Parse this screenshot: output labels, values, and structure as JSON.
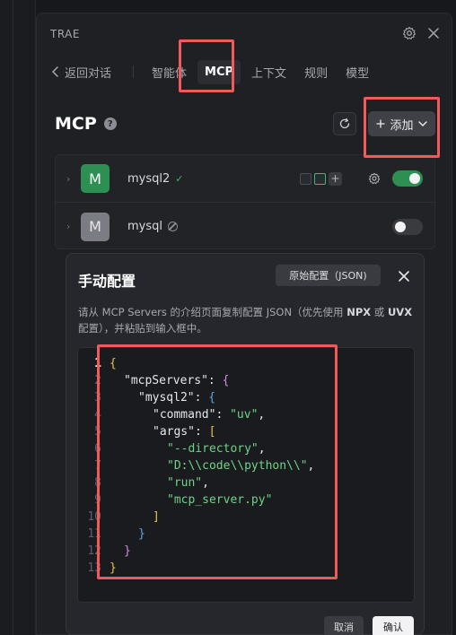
{
  "app": {
    "title": "TRAE"
  },
  "nav": {
    "back_label": "返回对话",
    "tabs": [
      {
        "label": "智能体"
      },
      {
        "label": "MCP"
      },
      {
        "label": "上下文"
      },
      {
        "label": "规则"
      },
      {
        "label": "模型"
      }
    ],
    "active_tab": "MCP"
  },
  "mcp": {
    "title": "MCP",
    "help": "?",
    "add_label": "添加",
    "servers": [
      {
        "avatar": "M",
        "name": "mysql2",
        "status": "connected",
        "enabled": true,
        "avatar_color": "#2e8f52"
      },
      {
        "avatar": "M",
        "name": "mysql",
        "status": "disabled",
        "enabled": false,
        "avatar_color": "#7b7d85"
      }
    ]
  },
  "modal": {
    "title": "手动配置",
    "raw_button": "原始配置（JSON)",
    "desc_prefix": "请从 MCP Servers 的介绍页面复制配置 JSON（优先使用 ",
    "desc_npx": "NPX",
    "desc_or": " 或 ",
    "desc_uvx": "UVX",
    "desc_suffix": "配置），并粘贴到输入框中。",
    "line_numbers": [
      "1",
      "2",
      "3",
      "4",
      "5",
      "6",
      "7",
      "8",
      "9",
      "10",
      "11",
      "12",
      "13"
    ],
    "code": {
      "l1": "{",
      "l2_key": "\"mcpServers\"",
      "l2_colon": ": ",
      "l2_brace": "{",
      "l3_key": "\"mysql2\"",
      "l3_colon": ": ",
      "l3_brace": "{",
      "l4_key": "\"command\"",
      "l4_colon": ": ",
      "l4_val": "\"uv\"",
      "l4_comma": ",",
      "l5_key": "\"args\"",
      "l5_colon": ": ",
      "l5_bracket": "[",
      "l6_val": "\"--directory\"",
      "l6_comma": ",",
      "l7_val": "\"D:\\\\code\\\\python\\\\\"",
      "l7_comma": ",",
      "l8_val": "\"run\"",
      "l8_comma": ",",
      "l9_val": "\"mcp_server.py\"",
      "l10": "]",
      "l11": "}",
      "l12": "}",
      "l13": "}"
    },
    "cancel_label": "取消",
    "ok_label": "确认"
  },
  "colors": {
    "accent_green": "#2e8f52",
    "highlight_red": "#ef5a5a",
    "primary_button": "#f2f2f4"
  }
}
